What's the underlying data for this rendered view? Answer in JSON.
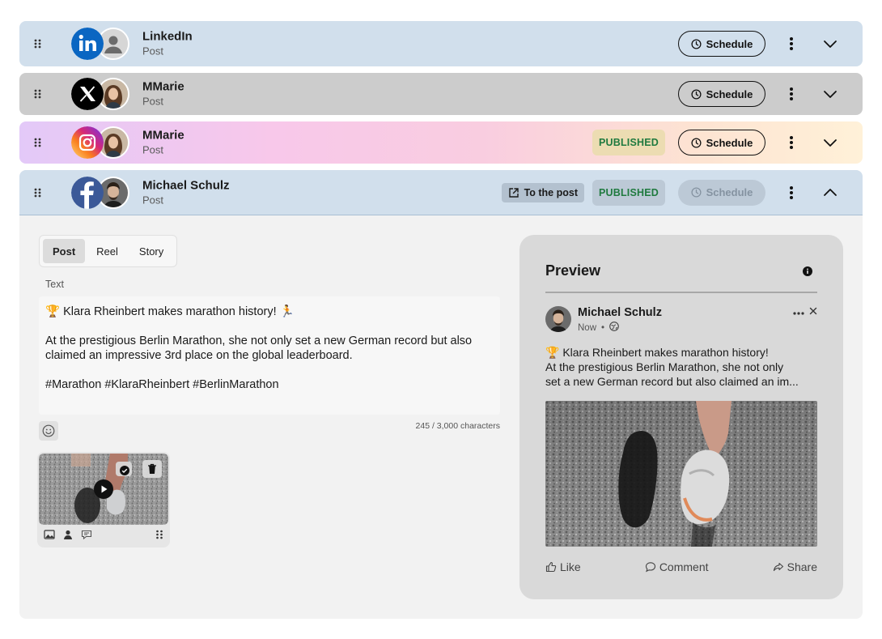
{
  "accounts": [
    {
      "network": "LinkedIn",
      "name": "LinkedIn",
      "type": "Post",
      "schedule_label": "Schedule"
    },
    {
      "network": "X",
      "name": "MMarie",
      "type": "Post",
      "schedule_label": "Schedule"
    },
    {
      "network": "Instagram",
      "name": "MMarie",
      "type": "Post",
      "status": "PUBLISHED",
      "schedule_label": "Schedule"
    },
    {
      "network": "Facebook",
      "name": "Michael Schulz",
      "type": "Post",
      "to_post_label": "To the post",
      "status": "PUBLISHED",
      "schedule_label": "Schedule",
      "expanded": true
    }
  ],
  "editor": {
    "tabs": [
      "Post",
      "Reel",
      "Story"
    ],
    "active_tab": "Post",
    "text_label": "Text",
    "lines": [
      "🏆 Klara Rheinbert makes marathon history! 🏃",
      "At the prestigious Berlin Marathon, she not only set a new German record but also claimed an impressive 3rd place on the global leaderboard.",
      "#Marathon #KlaraRheinbert #BerlinMarathon"
    ],
    "char_count": "245 / 3,000 characters"
  },
  "preview": {
    "title": "Preview",
    "author": "Michael Schulz",
    "time": "Now",
    "line1": "🏆 Klara Rheinbert makes marathon history!",
    "line2": "At the prestigious Berlin Marathon, she not only",
    "line3": "set a new German record but also claimed an im...",
    "like": "Like",
    "comment": "Comment",
    "share": "Share"
  },
  "colors": {
    "linkedin": "#0a66c2",
    "facebook": "#3b5998",
    "published_text": "#1f7a3f"
  }
}
